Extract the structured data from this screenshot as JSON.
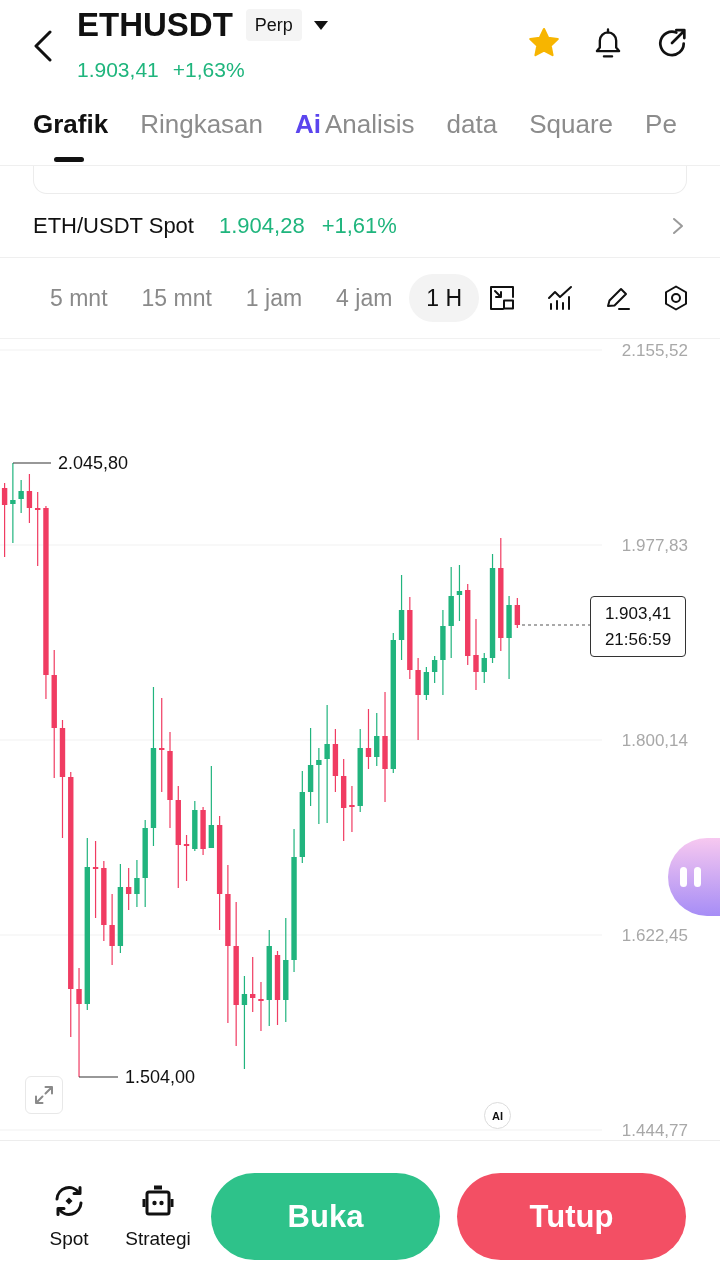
{
  "header": {
    "title": "ETHUSDT",
    "contract_type": "Perp",
    "price": "1.903,41",
    "change": "+1,63%",
    "favorite": true
  },
  "tabs": [
    {
      "label": "Grafik",
      "selected": true
    },
    {
      "label": "Ringkasan",
      "selected": false
    },
    {
      "label": "Analisis",
      "badge": "Ai",
      "selected": false
    },
    {
      "label": "data",
      "selected": false
    },
    {
      "label": "Square",
      "selected": false
    },
    {
      "label": "Pe",
      "selected": false
    }
  ],
  "spot_row": {
    "pair": "ETH/USDT Spot",
    "price": "1.904,28",
    "change": "+1,61%"
  },
  "timeframes": [
    {
      "label": "5 mnt",
      "selected": false
    },
    {
      "label": "15 mnt",
      "selected": false
    },
    {
      "label": "1 jam",
      "selected": false
    },
    {
      "label": "4 jam",
      "selected": false
    },
    {
      "label": "1 H",
      "selected": true
    }
  ],
  "chart": {
    "y_labels": [
      "2.155,52",
      "1.977,83",
      "1.800,14",
      "1.622,45",
      "1.444,77"
    ],
    "high_label": "2.045,80",
    "low_label": "1.504,00",
    "last_price": "1.903,41",
    "countdown": "21:56:59",
    "ai_badge": "AI"
  },
  "bottom_bar": {
    "shortcuts": [
      {
        "kind": "spot",
        "label": "Spot"
      },
      {
        "kind": "strategy",
        "label": "Strategi"
      }
    ],
    "buttons": [
      {
        "kind": "open",
        "label": "Buka"
      },
      {
        "kind": "close",
        "label": "Tutup"
      }
    ]
  }
}
